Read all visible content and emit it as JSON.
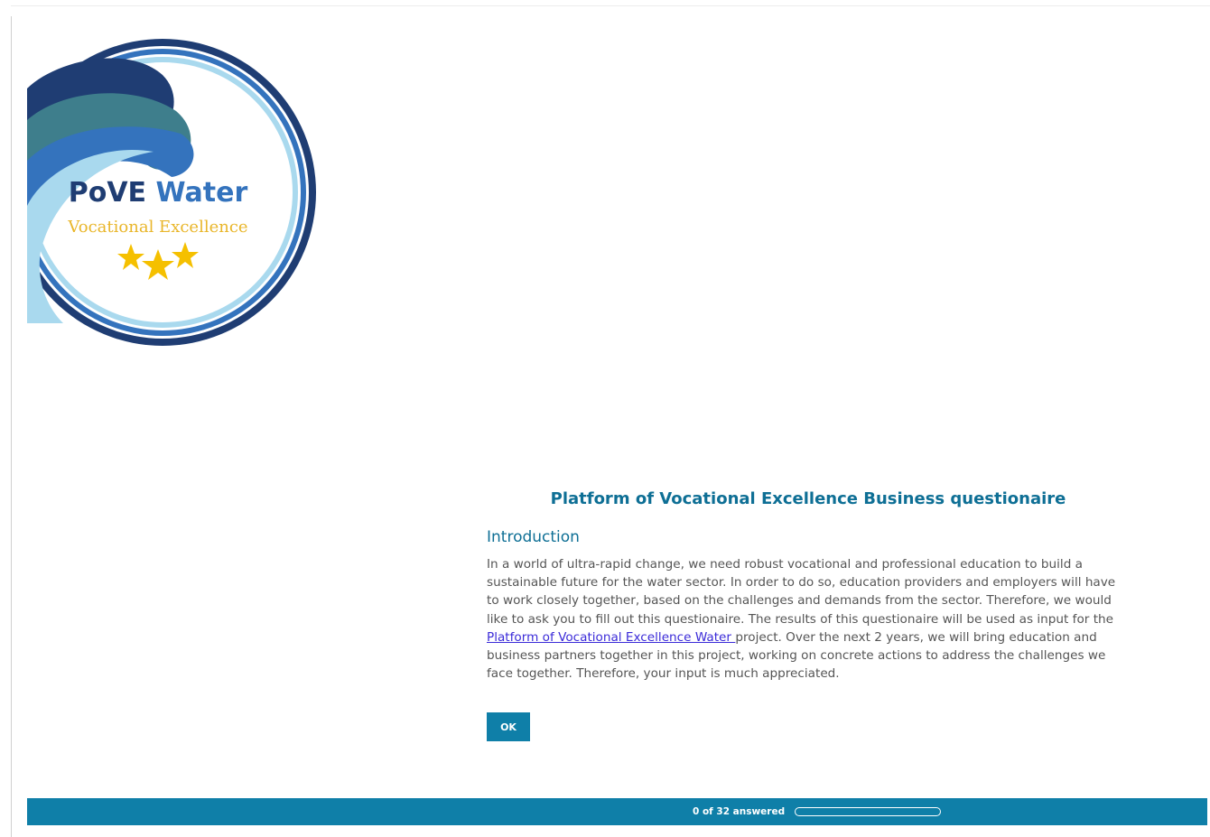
{
  "logo": {
    "title_part1": "PoVE",
    "title_part2": "Water",
    "subtitle": "Vocational Excellence",
    "colors": {
      "navy": "#1f3d73",
      "blue": "#3473bd",
      "light_blue": "#a9d9ee",
      "teal": "#3e7e8c",
      "gold": "#f5c000"
    }
  },
  "survey": {
    "title": "Platform of Vocational Excellence Business questionaire",
    "section_heading": "Introduction",
    "intro_part1": "In a world of ultra-rapid change, we need robust vocational and professional education to build a sustainable future for the water sector. In order to do so, education providers and employers will have to work closely together, based on the challenges and demands from the sector. Therefore, we would like to ask you to fill out this questionaire. The results of this questionaire will be used as input for the ",
    "intro_link": "Platform of Vocational Excellence Water ",
    "intro_part2": "project. Over the next 2 years, we will bring education and business partners together in this project, working on concrete actions to address the challenges we face together. Therefore, your input is much appreciated.",
    "ok_label": "OK"
  },
  "footer": {
    "progress_text": "0 of 32 answered",
    "answered": 0,
    "total": 32
  },
  "colors": {
    "accent": "#0f7fa8",
    "heading": "#0e6f95",
    "link": "#3b2bd8"
  }
}
